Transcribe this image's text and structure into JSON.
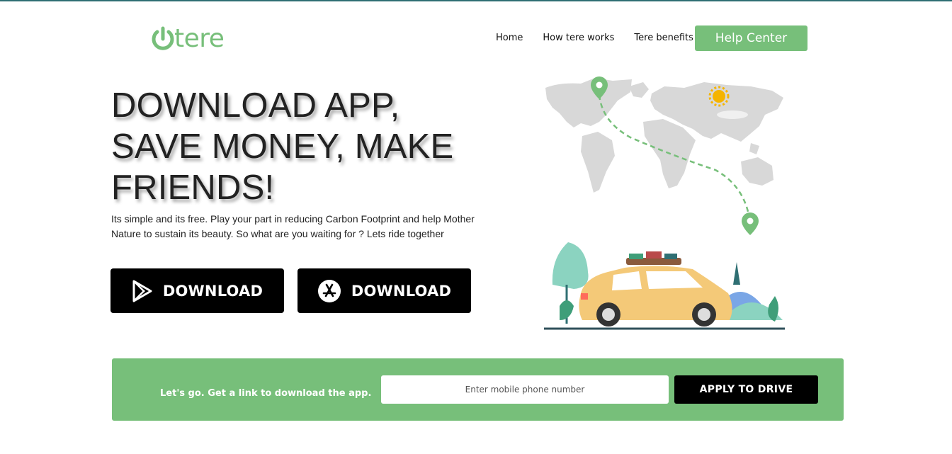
{
  "brand": {
    "logo_text": "tere",
    "accent_color": "#77bf7a"
  },
  "nav": {
    "items": [
      {
        "label": "Home"
      },
      {
        "label": "How tere works"
      },
      {
        "label": "Tere benefits"
      }
    ],
    "help_label": "Help Center"
  },
  "hero": {
    "title_lines": [
      "DOWNLOAD APP,",
      "SAVE MONEY, MAKE",
      "FRIENDS!"
    ],
    "subtitle_lines": [
      "Its simple and its free. Play your part in reducing Carbon Footprint and help Mother",
      "Nature to sustain its beauty. So what are you waiting for ? Lets ride together"
    ]
  },
  "downloads": [
    {
      "label": "DOWNLOAD",
      "icon": "google-play-icon"
    },
    {
      "label": "DOWNLOAD",
      "icon": "app-store-icon"
    }
  ],
  "cta": {
    "text": "Let's go. Get a link to download the app.",
    "phone_placeholder": "Enter mobile phone number",
    "apply_label": "APPLY TO DRIVE"
  }
}
